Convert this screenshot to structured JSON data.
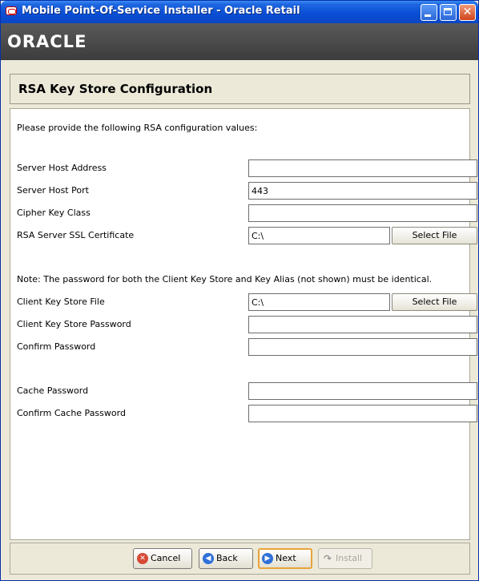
{
  "window": {
    "title": "Mobile Point-Of-Service Installer - Oracle Retail",
    "controls": {
      "minimize_icon": "minimize-icon",
      "maximize_icon": "maximize-icon",
      "close_icon": "close-icon",
      "close_glyph": "✕"
    }
  },
  "brand": {
    "logo_text": "ORACLE"
  },
  "page": {
    "title": "RSA Key Store Configuration",
    "instructions": "Please provide the following RSA configuration values:",
    "note": "Note:  The password for both the Client Key Store and Key Alias (not shown) must be identical."
  },
  "fields": {
    "server_host_address": {
      "label": "Server Host Address",
      "value": ""
    },
    "server_host_port": {
      "label": "Server Host Port",
      "value": "443"
    },
    "cipher_key_class": {
      "label": "Cipher Key Class",
      "value": ""
    },
    "rsa_server_ssl_certificate": {
      "label": "RSA Server SSL Certificate",
      "value": "C:\\",
      "button": "Select File"
    },
    "client_key_store_file": {
      "label": "Client Key Store File",
      "value": "C:\\",
      "button": "Select File"
    },
    "client_key_store_password": {
      "label": "Client Key Store Password",
      "value": ""
    },
    "confirm_password": {
      "label": "Confirm Password",
      "value": ""
    },
    "cache_password": {
      "label": "Cache Password",
      "value": ""
    },
    "confirm_cache_password": {
      "label": "Confirm Cache Password",
      "value": ""
    }
  },
  "buttons": {
    "cancel": {
      "label": "Cancel",
      "icon": "cancel-icon",
      "glyph": "✕"
    },
    "back": {
      "label": "Back",
      "icon": "back-arrow-icon",
      "glyph": "◀"
    },
    "next": {
      "label": "Next",
      "icon": "next-arrow-icon",
      "glyph": "▶"
    },
    "install": {
      "label": "Install",
      "icon": "install-arrow-icon",
      "glyph": "↷",
      "enabled": false
    }
  },
  "colors": {
    "title_bar": "#0a4fd6",
    "brand_bar": "#4a4a4a",
    "dialog_background": "#ece9d8",
    "default_button_border": "#e8a33a",
    "cancel_icon": "#d64a36"
  }
}
